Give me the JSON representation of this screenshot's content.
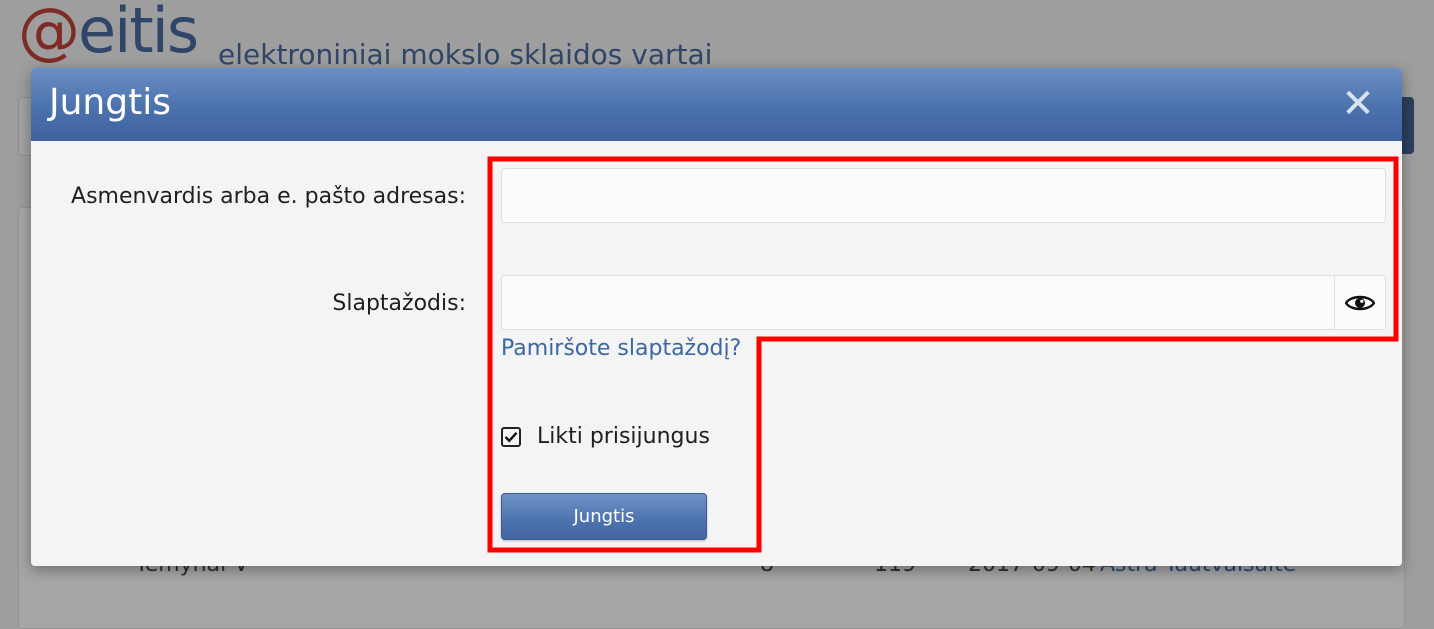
{
  "background": {
    "logo_at": "@",
    "logo_rest": "eitis",
    "tagline": "elektroniniai mokslo sklaidos vartai",
    "row_topic": "Temynai ∨",
    "row_count1": "8",
    "row_count2": "119",
    "row_date": "2017-09-04 ·",
    "row_author": "Astra Tautvaišaitė"
  },
  "modal": {
    "title": "Jungtis",
    "close_symbol": "✕",
    "username_label": "Asmenvardis arba e. pašto adresas:",
    "username_value": "",
    "password_label": "Slaptažodis:",
    "password_value": "",
    "forgot_link": "Pamiršote slaptažodį?",
    "remember_label": "Likti prisijungus",
    "remember_checked": true,
    "submit_label": "Jungtis"
  },
  "colors": {
    "header": "#4c72ad",
    "link": "#3b67a3",
    "highlight": "#ff0000"
  }
}
